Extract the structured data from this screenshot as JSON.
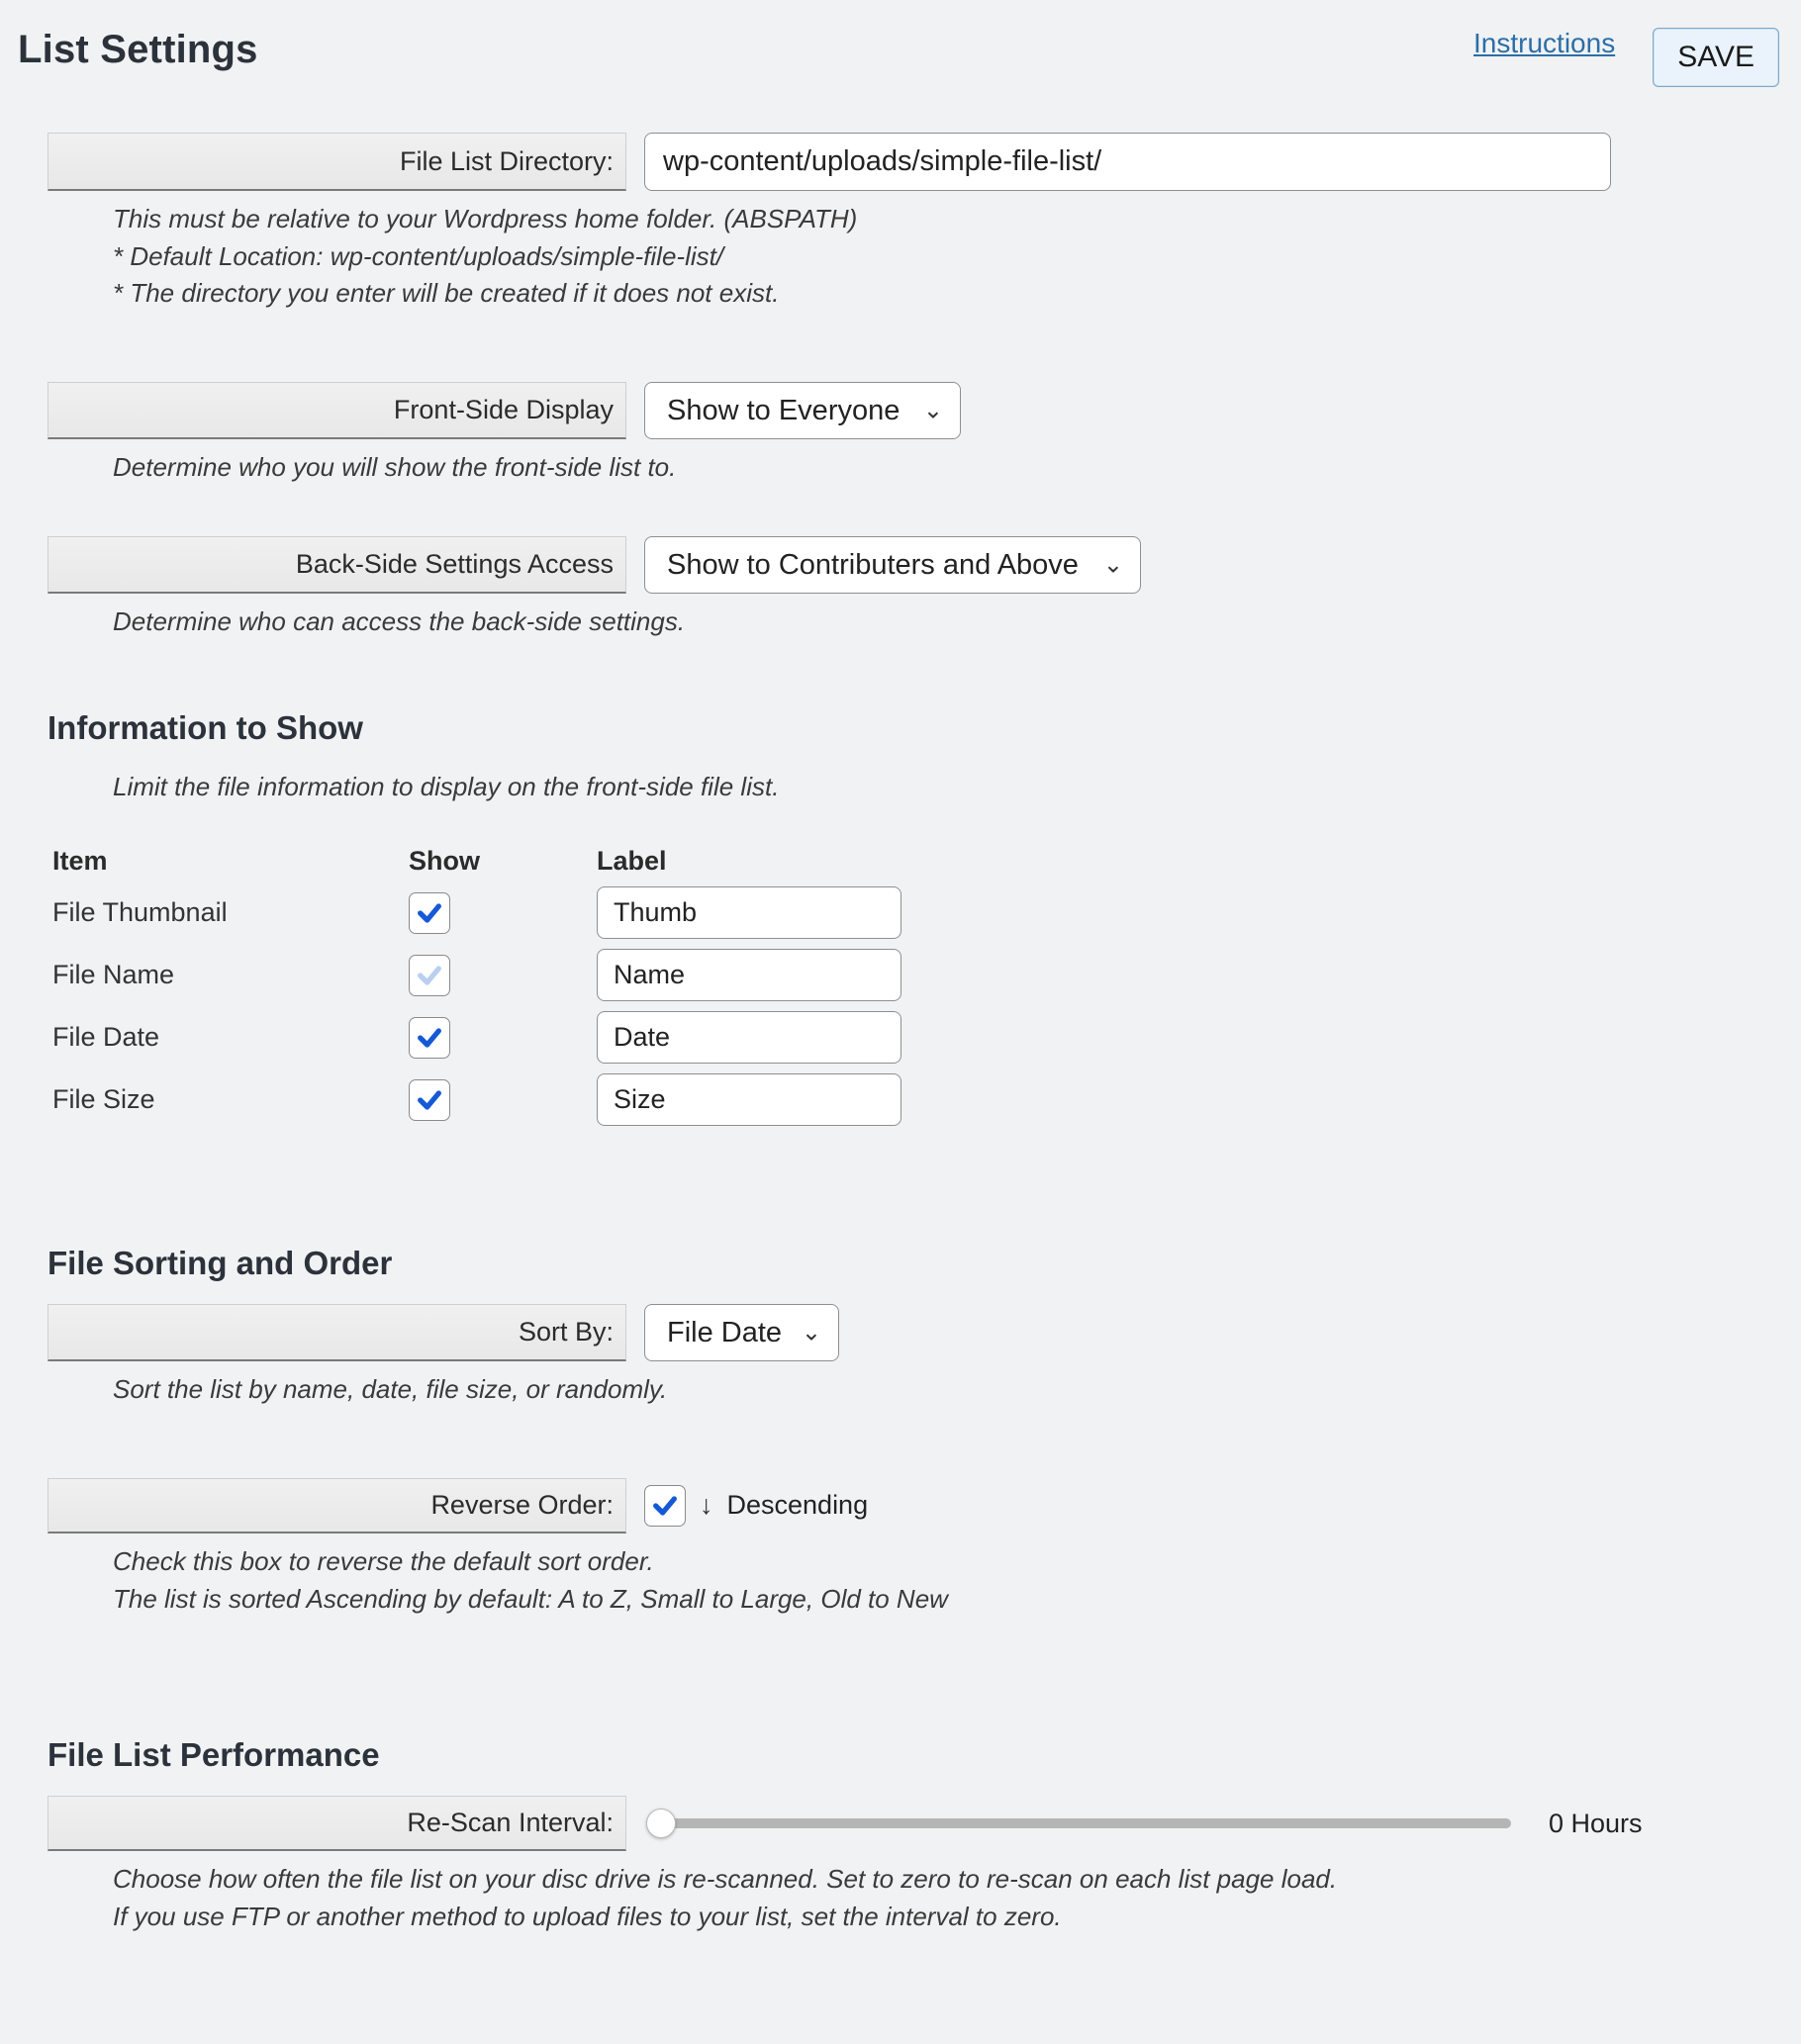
{
  "header": {
    "title": "List Settings",
    "instructions": "Instructions",
    "save": "SAVE"
  },
  "directory": {
    "label": "File List Directory:",
    "value": "wp-content/uploads/simple-file-list/",
    "note1": "This must be relative to your Wordpress home folder. (ABSPATH)",
    "note2": "* Default Location: wp-content/uploads/simple-file-list/",
    "note3": "* The directory you enter will be created if it does not exist."
  },
  "frontside": {
    "label": "Front-Side Display",
    "value": "Show to Everyone",
    "note": "Determine who you will show the front-side list to."
  },
  "backside": {
    "label": "Back-Side Settings Access",
    "value": "Show to Contributers and Above",
    "note": "Determine who can access the back-side settings."
  },
  "info": {
    "heading": "Information to Show",
    "note": "Limit the file information to display on the front-side file list.",
    "cols": {
      "item": "Item",
      "show": "Show",
      "label": "Label"
    },
    "rows": [
      {
        "item": "File Thumbnail",
        "checked": true,
        "dim": false,
        "label": "Thumb"
      },
      {
        "item": "File Name",
        "checked": true,
        "dim": true,
        "label": "Name"
      },
      {
        "item": "File Date",
        "checked": true,
        "dim": false,
        "label": "Date"
      },
      {
        "item": "File Size",
        "checked": true,
        "dim": false,
        "label": "Size"
      }
    ]
  },
  "sort": {
    "heading": "File Sorting and Order",
    "sortby_label": "Sort By:",
    "sortby_value": "File Date",
    "sortby_note": "Sort the list by name, date, file size, or randomly.",
    "reverse_label": "Reverse Order:",
    "reverse_checked": true,
    "reverse_text": "Descending",
    "reverse_note1": "Check this box to reverse the default sort order.",
    "reverse_note2": "The list is sorted Ascending by default: A to Z, Small to Large, Old to New"
  },
  "perf": {
    "heading": "File List Performance",
    "rescan_label": "Re-Scan Interval:",
    "rescan_value": "0 Hours",
    "rescan_note1": "Choose how often the file list on your disc drive is re-scanned. Set to zero to re-scan on each list page load.",
    "rescan_note2": "If you use FTP or another method to upload files to your list, set the interval to zero."
  }
}
